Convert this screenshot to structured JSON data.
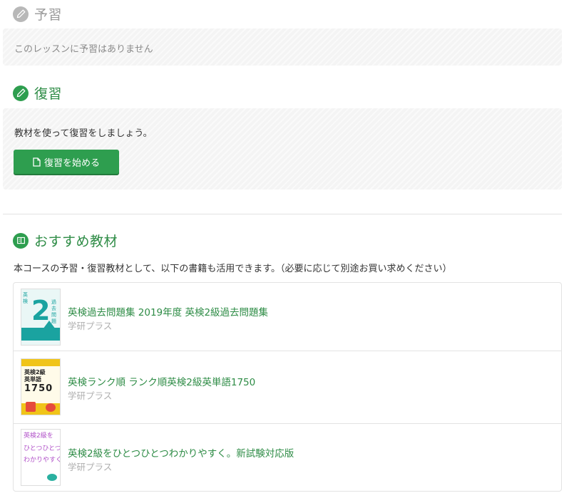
{
  "yoshu": {
    "title": "予習",
    "icon": "pencil-icon",
    "message": "このレッスンに予習はありません"
  },
  "fukushu": {
    "title": "復習",
    "icon": "pencil-icon",
    "message": "教材を使って復習をしましょう。",
    "button_label": "復習を始める",
    "button_icon": "document-icon"
  },
  "osusume": {
    "title": "おすすめ教材",
    "icon": "book-icon",
    "intro": "本コースの予習・復習教材として、以下の書籍も活用できます。（必要に応じて別途お買い求めください）",
    "books": [
      {
        "title": "英検過去問題集 2019年度 英検2級過去問題集",
        "publisher": "学研プラス"
      },
      {
        "title": "英検ランク順 ランク順英検2級英単語1750",
        "publisher": "学研プラス"
      },
      {
        "title": "英検2級をひとつひとつわかりやすく。新試験対応版",
        "publisher": "学研プラス"
      }
    ]
  },
  "colors": {
    "accent": "#2e9e4f",
    "accent_text": "#2e8c46",
    "disabled": "#b8b8b8",
    "publisher": "#b0b0b0"
  }
}
